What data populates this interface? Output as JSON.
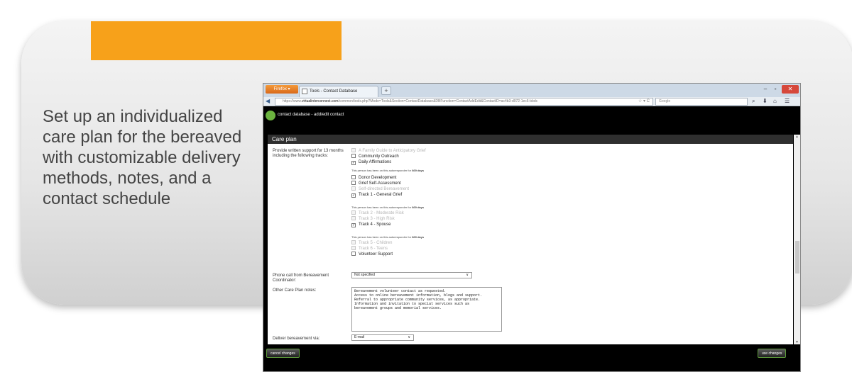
{
  "slide": {
    "text": "Set up an individualized care plan for the bereaved with customizable delivery methods, notes, and a contact schedule",
    "accent_color": "#f7a11a"
  },
  "browser": {
    "firefox_label": "Firefox ▾",
    "tab_title": "Tools - Contact Database",
    "new_tab": "+",
    "url_prefix": "https://www.",
    "url_domain": "virtualinterconnect.com",
    "url_path": "/common/tools.php?Mode=Tools&Section=ContactDatabase&DBFunction=ContactAddEdit&ContactID=ac4b3-d972-1ec6-bbdc",
    "url_end": "☆ ▾ C",
    "search_placeholder": "Google",
    "win_min": "–",
    "win_max": "▫",
    "win_close": "✕"
  },
  "app": {
    "title": "contact database - add/edit contact"
  },
  "care_plan": {
    "header": "Care plan",
    "tracks_label": "Provide written support for 13 months including the following tracks:",
    "tracks": [
      {
        "label": "A Family Guide to Anticipatory Grief",
        "checked": false,
        "disabled": true
      },
      {
        "label": "Community Outreach",
        "checked": false,
        "disabled": false
      },
      {
        "label": "Daily Affirmations",
        "checked": true,
        "disabled": false
      },
      {
        "label": "Donor Development",
        "checked": false,
        "disabled": false
      },
      {
        "label": "Grief Self-Assessment",
        "checked": false,
        "disabled": false
      },
      {
        "label": "Self-directed Bereavement",
        "checked": false,
        "disabled": true
      },
      {
        "label": "Track 1 - General Grief",
        "checked": true,
        "disabled": false
      },
      {
        "label": "Track 2 - Moderate Risk",
        "checked": false,
        "disabled": true
      },
      {
        "label": "Track 3 - High Risk",
        "checked": false,
        "disabled": true
      },
      {
        "label": "Track 4 - Spouse",
        "checked": true,
        "disabled": false
      },
      {
        "label": "Track 5 - Children",
        "checked": false,
        "disabled": true
      },
      {
        "label": "Track 6 - Teens",
        "checked": false,
        "disabled": true
      },
      {
        "label": "Volunteer Support",
        "checked": false,
        "disabled": false
      }
    ],
    "autoresponder_note_prefix": "This person has been on this autoresponder for",
    "autoresponder_days": "669 days",
    "phone_label": "Phone call from Bereavement Coordinator:",
    "phone_value": "Not specified",
    "notes_label": "Other Care Plan notes:",
    "notes_value": "Bereavement volunteer contact as requested.\nAccess to online bereavement information, blogs and support.\nReferral to appropriate community services, as appropriate.\nInformation and invitation to special services such as\nbereavement groups and memorial services.",
    "deliver_label": "Deliver bereavement via:",
    "deliver_value": "E-mail"
  },
  "footer": {
    "cancel_label": "cancel changes",
    "save_label": "use changes"
  }
}
